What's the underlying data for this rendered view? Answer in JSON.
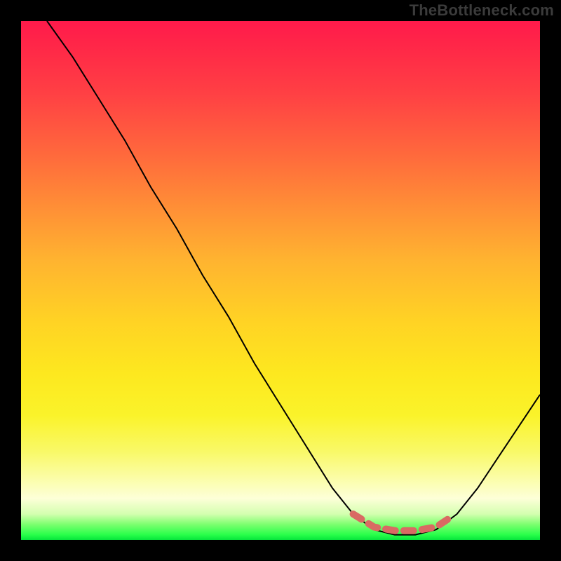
{
  "watermark": "TheBottleneck.com",
  "chart_data": {
    "type": "line",
    "title": "",
    "xlabel": "",
    "ylabel": "",
    "xlim": [
      0,
      100
    ],
    "ylim": [
      0,
      100
    ],
    "grid": false,
    "legend": false,
    "series": [
      {
        "name": "bottleneck-curve",
        "color": "#000000",
        "stroke_width": 2,
        "points": [
          {
            "x": 5,
            "y": 100
          },
          {
            "x": 10,
            "y": 93
          },
          {
            "x": 15,
            "y": 85
          },
          {
            "x": 20,
            "y": 77
          },
          {
            "x": 25,
            "y": 68
          },
          {
            "x": 30,
            "y": 60
          },
          {
            "x": 35,
            "y": 51
          },
          {
            "x": 40,
            "y": 43
          },
          {
            "x": 45,
            "y": 34
          },
          {
            "x": 50,
            "y": 26
          },
          {
            "x": 55,
            "y": 18
          },
          {
            "x": 60,
            "y": 10
          },
          {
            "x": 64,
            "y": 5
          },
          {
            "x": 68,
            "y": 2
          },
          {
            "x": 72,
            "y": 1
          },
          {
            "x": 76,
            "y": 1
          },
          {
            "x": 80,
            "y": 2
          },
          {
            "x": 84,
            "y": 5
          },
          {
            "x": 88,
            "y": 10
          },
          {
            "x": 92,
            "y": 16
          },
          {
            "x": 96,
            "y": 22
          },
          {
            "x": 100,
            "y": 28
          }
        ]
      },
      {
        "name": "optimal-range-marker",
        "color": "#d96a63",
        "stroke_width": 10,
        "stroke_linecap": "round",
        "stroke_dasharray": "14 12",
        "points": [
          {
            "x": 64,
            "y": 5
          },
          {
            "x": 68,
            "y": 2.5
          },
          {
            "x": 72,
            "y": 1.8
          },
          {
            "x": 76,
            "y": 1.8
          },
          {
            "x": 80,
            "y": 2.5
          },
          {
            "x": 83,
            "y": 4.5
          }
        ]
      }
    ],
    "background_gradient": {
      "orientation": "vertical",
      "stops": [
        {
          "pos": 0.0,
          "color": "#ff1a4b"
        },
        {
          "pos": 0.3,
          "color": "#ff7a38"
        },
        {
          "pos": 0.6,
          "color": "#ffd324"
        },
        {
          "pos": 0.82,
          "color": "#faf84a"
        },
        {
          "pos": 0.92,
          "color": "#fdffd8"
        },
        {
          "pos": 1.0,
          "color": "#06e53c"
        }
      ]
    }
  }
}
